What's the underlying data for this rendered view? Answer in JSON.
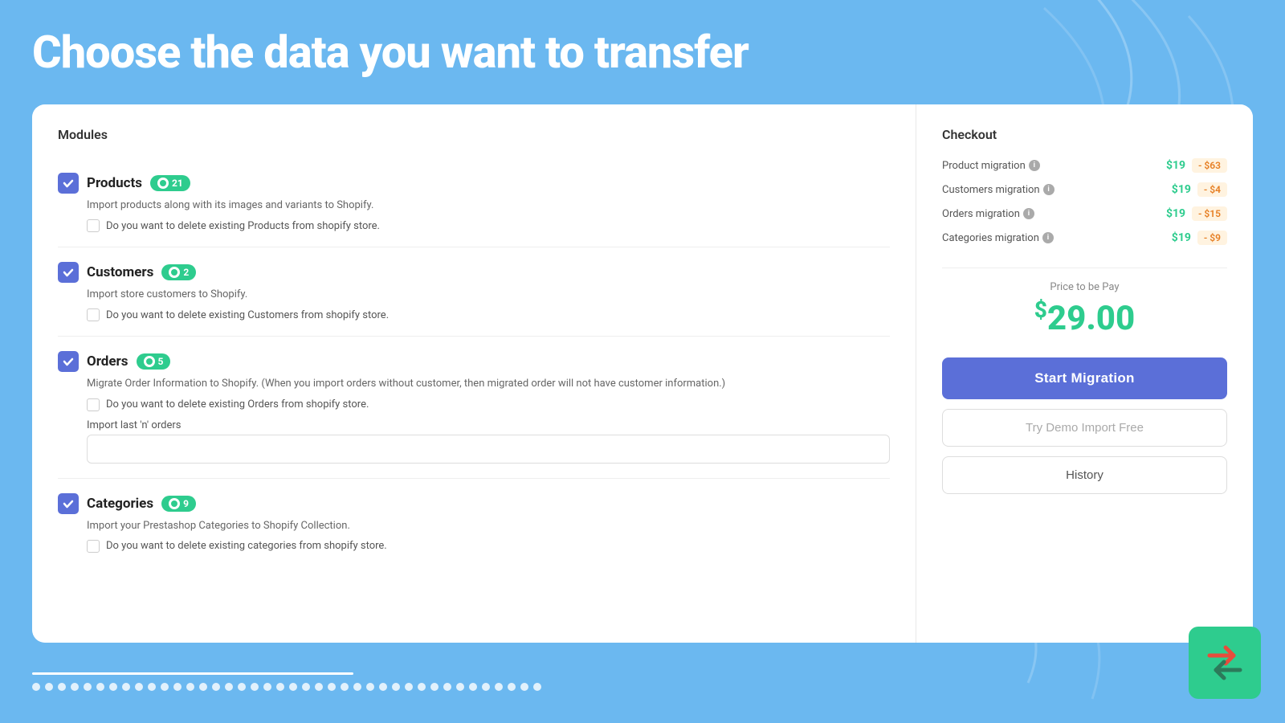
{
  "page": {
    "title": "Choose the data you want to transfer",
    "background_color": "#6bb8f0"
  },
  "modules": {
    "section_title": "Modules",
    "items": [
      {
        "name": "Products",
        "count": 21,
        "checked": true,
        "description": "Import products along with its images and variants to Shopify.",
        "sub_option": "Do you want to delete existing Products from shopify store.",
        "sub_checked": false,
        "has_import_last": false
      },
      {
        "name": "Customers",
        "count": 2,
        "checked": true,
        "description": "Import store customers to Shopify.",
        "sub_option": "Do you want to delete existing Customers from shopify store.",
        "sub_checked": false,
        "has_import_last": false
      },
      {
        "name": "Orders",
        "count": 5,
        "checked": true,
        "description": "Migrate Order Information to Shopify. (When you import orders without customer, then migrated order will not have customer information.)",
        "sub_option": "Do you want to delete existing Orders from shopify store.",
        "sub_checked": false,
        "has_import_last": true,
        "import_last_label": "Import last 'n' orders",
        "import_last_placeholder": ""
      },
      {
        "name": "Categories",
        "count": 9,
        "checked": true,
        "description": "Import your Prestashop Categories to Shopify Collection.",
        "sub_option": "Do you want to delete existing categories from shopify store.",
        "sub_checked": false,
        "has_import_last": false
      }
    ]
  },
  "checkout": {
    "section_title": "Checkout",
    "pricing_rows": [
      {
        "label": "Product migration",
        "price": "$19",
        "discount": "- $63"
      },
      {
        "label": "Customers migration",
        "price": "$19",
        "discount": "- $4"
      },
      {
        "label": "Orders migration",
        "price": "$19",
        "discount": "- $15"
      },
      {
        "label": "Categories migration",
        "price": "$19",
        "discount": "- $9"
      }
    ],
    "price_label": "Price to be Pay",
    "total_price": "29.00",
    "currency_symbol": "$",
    "start_migration_label": "Start Migration",
    "demo_label": "Try Demo Import Free",
    "history_label": "History"
  },
  "bottom_dots_count": 40,
  "icons": {
    "checkmark": "✓",
    "info": "i",
    "transfer_icon": "⇄"
  }
}
